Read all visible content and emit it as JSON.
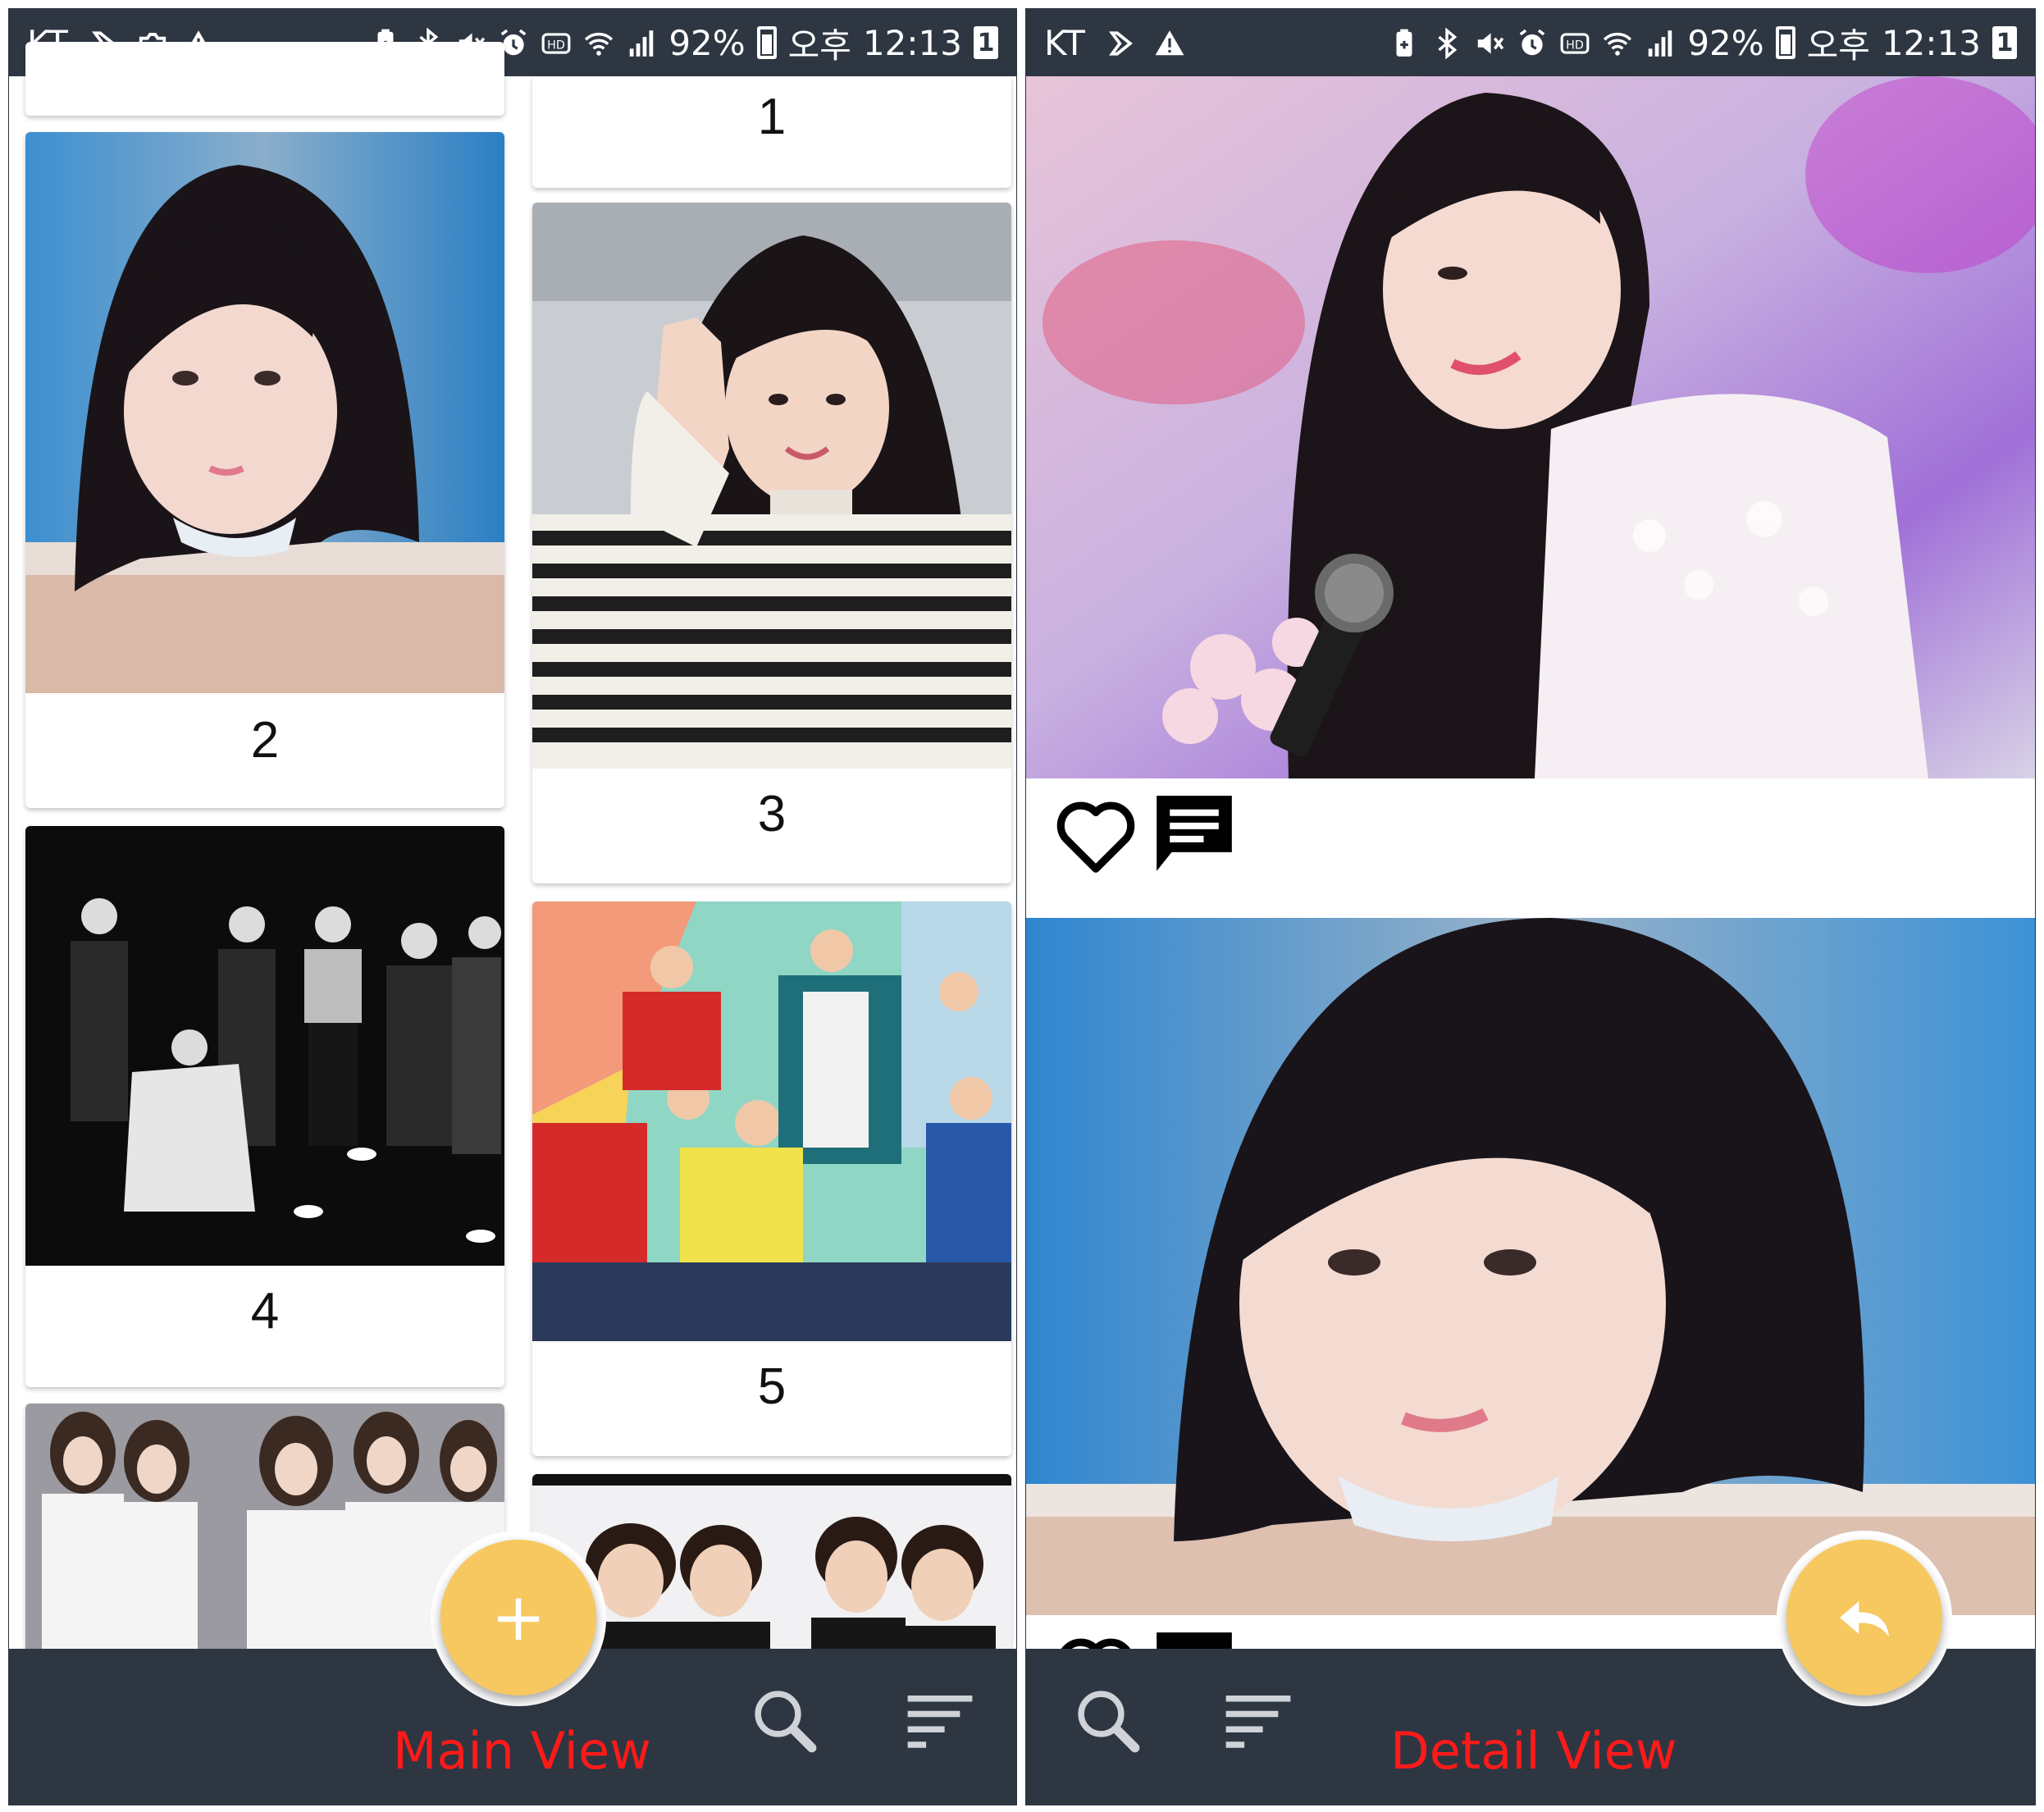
{
  "status_bar": {
    "carrier": "KT",
    "battery_percent": "92%",
    "period": "오후",
    "time": "12:13",
    "notification_count": "1",
    "icons": [
      "video-icon",
      "photo-icon",
      "warning-icon",
      "battery-saver-icon",
      "bluetooth-icon",
      "mute-icon",
      "alarm-icon",
      "hd-icon",
      "wifi-icon",
      "signal-icon",
      "battery-icon"
    ]
  },
  "main_view": {
    "caption": "Main View",
    "cards": [
      {
        "label": "1",
        "image": "photo-partial-top"
      },
      {
        "label": "2",
        "image": "photo-girl-dark-hair"
      },
      {
        "label": "3",
        "image": "photo-girl-waving-striped-shirt"
      },
      {
        "label": "4",
        "image": "photo-group-black-and-white"
      },
      {
        "label": "5",
        "image": "photo-group-colorful"
      },
      {
        "label": "",
        "image": "photo-girl-group-white-shirts"
      },
      {
        "label": "",
        "image": "photo-group-billboard"
      }
    ],
    "fab": {
      "icon": "plus-icon",
      "symbol": "+"
    },
    "bar_icons": [
      "search-icon",
      "sort-icon"
    ]
  },
  "detail_view": {
    "caption": "Detail View",
    "posts": [
      {
        "image": "photo-girl-microphone-flowers",
        "actions": [
          "heart-icon",
          "comment-icon"
        ]
      },
      {
        "image": "photo-girl-dark-hair-closeup",
        "actions": [
          "heart-icon",
          "comment-icon"
        ]
      }
    ],
    "fab": {
      "icon": "reply-icon"
    },
    "bar_icons": [
      "search-icon",
      "sort-icon"
    ]
  },
  "colors": {
    "bar": "#2e3642",
    "fab": "#f6c85f",
    "caption": "#ff1a1a",
    "card_bg": "#ffffff"
  }
}
